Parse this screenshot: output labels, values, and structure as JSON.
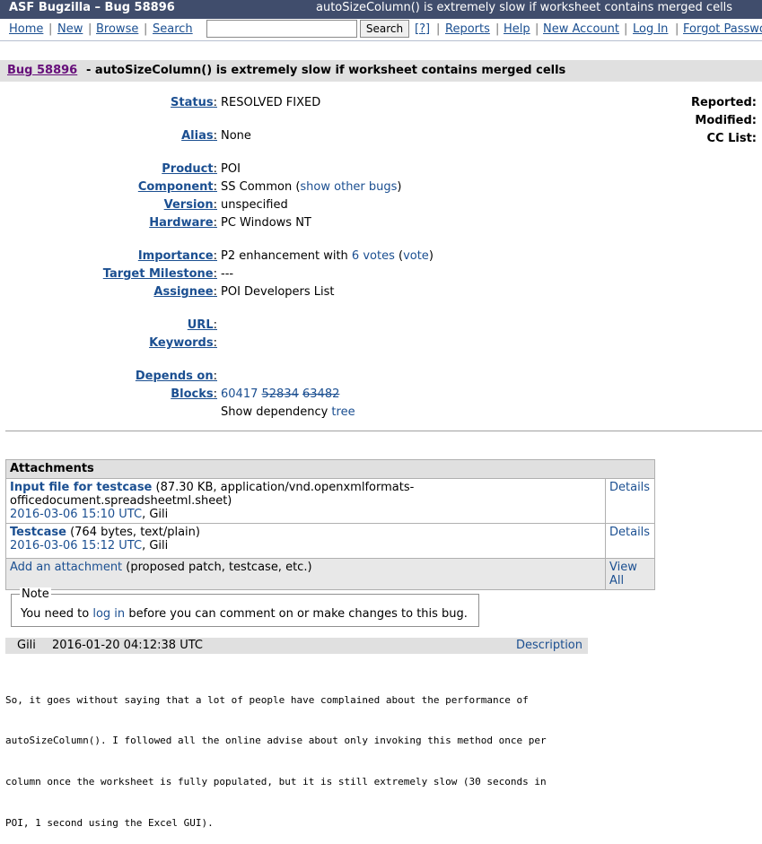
{
  "titlebar": {
    "site": "ASF Bugzilla – Bug 58896",
    "summary": "autoSizeColumn() is extremely slow if worksheet contains merged cells"
  },
  "nav": {
    "home": "Home",
    "new": "New",
    "browse": "Browse",
    "search": "Search",
    "search_button": "Search",
    "help_q": "[?]",
    "reports": "Reports",
    "help": "Help",
    "new_account": "New Account",
    "log_in": "Log In",
    "forgot": "Forgot Password",
    "sep": "|",
    "search_value": ""
  },
  "bug": {
    "link": "Bug 58896",
    "summary": "- autoSizeColumn() is extremely slow if worksheet contains merged cells"
  },
  "fields": {
    "status_label": "Status",
    "status_value": "RESOLVED FIXED",
    "alias_label": "Alias",
    "alias_value": "None",
    "product_label": "Product",
    "product_value": "POI",
    "component_label": "Component",
    "component_value": "SS Common",
    "show_other_bugs": "show other bugs",
    "version_label": "Version",
    "version_value": "unspecified",
    "hardware_label": "Hardware",
    "hardware_value": "PC Windows NT",
    "importance_label": "Importance",
    "importance_value": "P2 enhancement with",
    "votes_link": "6 votes",
    "vote_link": "vote",
    "target_label": "Target Milestone",
    "target_value": "---",
    "assignee_label": "Assignee",
    "assignee_value": "POI Developers List",
    "url_label": "URL",
    "keywords_label": "Keywords",
    "depends_label": "Depends on",
    "blocks_label": "Blocks",
    "blocks": [
      "60417",
      "52834",
      "63482"
    ],
    "show_dependency": "Show dependency",
    "tree_link": "tree"
  },
  "right_fields": {
    "reported": "Reported:",
    "modified": "Modified:",
    "cc_list": "CC List:"
  },
  "attachments": {
    "header": "Attachments",
    "items": [
      {
        "name": "Input file for testcase",
        "meta": "(87.30 KB, application/vnd.openxmlformats-officedocument.spreadsheetml.sheet)",
        "date": "2016-03-06 15:10 UTC",
        "author": "Gili",
        "details": "Details"
      },
      {
        "name": "Testcase",
        "meta": "(764 bytes, text/plain)",
        "date": "2016-03-06 15:12 UTC",
        "author": "Gili",
        "details": "Details"
      }
    ],
    "add": "Add an attachment",
    "add_hint": "(proposed patch, testcase, etc.)",
    "view_all": "View All"
  },
  "note": {
    "legend": "Note",
    "prefix": "You need to",
    "log_in": "log in",
    "suffix": "before you can comment on or make changes to this bug."
  },
  "comment": {
    "author": "Gili",
    "date": "2016-01-20 04:12:38 UTC",
    "description_link": "Description",
    "lines": [
      "So, it goes without saying that a lot of people have complained about the performance of",
      "autoSizeColumn(). I followed all the online advise about only invoking this method once per",
      "column once the worksheet is fully populated, but it is still extremely slow (30 seconds in",
      "POI, 1 second using the Excel GUI)."
    ]
  }
}
